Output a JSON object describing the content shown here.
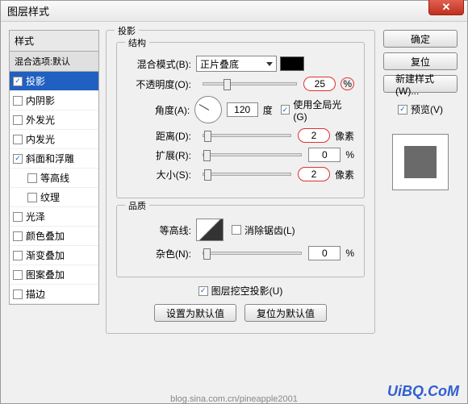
{
  "title": "图层样式",
  "left": {
    "header": "样式",
    "blend_label": "混合选项:默认",
    "items": [
      {
        "label": "投影",
        "checked": true,
        "selected": true
      },
      {
        "label": "内阴影",
        "checked": false
      },
      {
        "label": "外发光",
        "checked": false
      },
      {
        "label": "内发光",
        "checked": false
      },
      {
        "label": "斜面和浮雕",
        "checked": true
      },
      {
        "label": "等高线",
        "checked": false,
        "indent": true
      },
      {
        "label": "纹理",
        "checked": false,
        "indent": true
      },
      {
        "label": "光泽",
        "checked": false
      },
      {
        "label": "颜色叠加",
        "checked": false
      },
      {
        "label": "渐变叠加",
        "checked": false
      },
      {
        "label": "图案叠加",
        "checked": false
      },
      {
        "label": "描边",
        "checked": false
      }
    ]
  },
  "center": {
    "section_title": "投影",
    "struct_title": "结构",
    "blend_mode_label": "混合模式(B):",
    "blend_mode_value": "正片叠底",
    "opacity_label": "不透明度(O):",
    "opacity_value": "25",
    "opacity_unit": "%",
    "angle_label": "角度(A):",
    "angle_value": "120",
    "angle_unit": "度",
    "use_global_label": "使用全局光(G)",
    "distance_label": "距离(D):",
    "distance_value": "2",
    "distance_unit": "像素",
    "spread_label": "扩展(R):",
    "spread_value": "0",
    "spread_unit": "%",
    "size_label": "大小(S):",
    "size_value": "2",
    "size_unit": "像素",
    "quality_title": "品质",
    "contour_label": "等高线:",
    "antialias_label": "消除锯齿(L)",
    "noise_label": "杂色(N):",
    "noise_value": "0",
    "noise_unit": "%",
    "knockout_label": "图层挖空投影(U)",
    "set_default_btn": "设置为默认值",
    "reset_default_btn": "复位为默认值"
  },
  "right": {
    "ok": "确定",
    "cancel": "复位",
    "new_style": "新建样式(W)...",
    "preview_label": "预览(V)"
  },
  "watermark": "UiBQ.CoM",
  "url": "blog.sina.com.cn/pineapple2001"
}
